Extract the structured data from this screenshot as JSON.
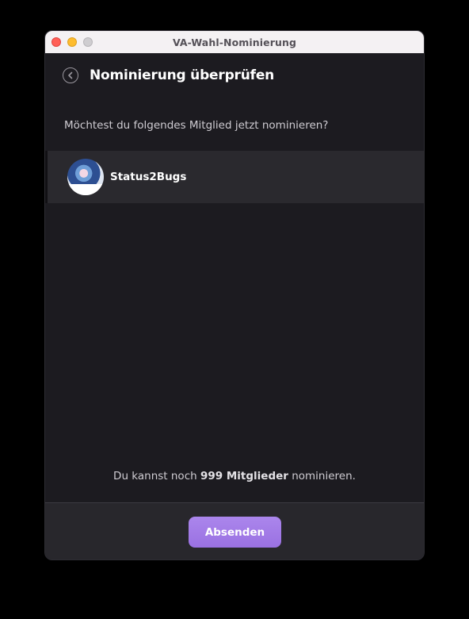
{
  "window": {
    "title": "VA-Wahl-Nominierung"
  },
  "header": {
    "title": "Nominierung überprüfen",
    "back_icon": "chevron-left-circle-icon"
  },
  "main": {
    "question": "Möchtest du folgendes Mitglied jetzt nominieren?",
    "member": {
      "name": "Status2Bugs"
    },
    "remaining_prefix": "Du kannst noch ",
    "remaining_count": "999 Mitglieder",
    "remaining_suffix": " nominieren."
  },
  "footer": {
    "submit_label": "Absenden"
  },
  "colors": {
    "accent": "#a07be6",
    "background": "#1c1b20",
    "row": "#2a292e"
  }
}
